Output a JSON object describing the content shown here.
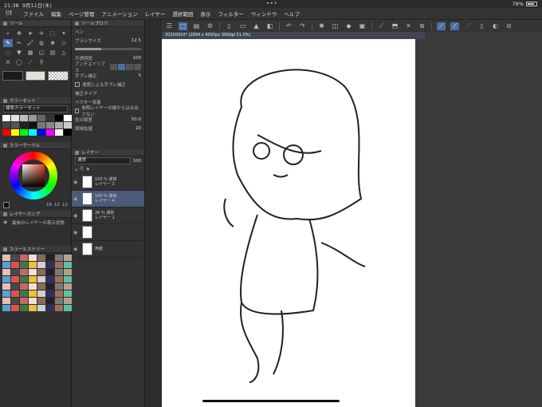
{
  "status": {
    "time": "21:38",
    "date": "9月11日(木)",
    "battery": "78%",
    "battery_level": 0.78
  },
  "menu": [
    "ファイル",
    "編集",
    "ページ管理",
    "アニメーション",
    "レイヤー",
    "選択範囲",
    "表示",
    "フィルター",
    "ウィンドウ",
    "ヘルプ"
  ],
  "tool_panel": {
    "title": "ツール"
  },
  "tool_property": {
    "title": "ツールプロパ",
    "tab": "ペン",
    "brush_size_label": "ブラシサイズ",
    "brush_size": "12.5",
    "opacity_label": "不透明度",
    "opacity": "100",
    "antialias_label": "アンチエイリアス",
    "stabilization_label": "手ブレ補正",
    "stabilization": "5",
    "speed_stab_label": "速度による手ブレ補正",
    "correction_type_label": "補正タイプ",
    "vector_label": "ベクター吸着",
    "ref_layer_label": "参照レイヤーの線からはみ出さない",
    "color_err_label": "色の誤差",
    "color_err": "50.0",
    "area_label": "領域拡縮",
    "area": "20"
  },
  "color_set": {
    "title": "カラーセット",
    "name": "標準カラーセット"
  },
  "color_circle": {
    "title": "カラーサークル",
    "h": "16",
    "s": "12",
    "v": "12"
  },
  "layer_comp": {
    "title": "レイヤーカンプ",
    "item": "最後のレイヤーの表示状態"
  },
  "color_history": {
    "title": "カラーヒストリー"
  },
  "layers": {
    "title": "レイヤー",
    "blend": "通常",
    "opacity": "100",
    "items": [
      {
        "line1": "100 % 通常",
        "line2": "レイヤー 3",
        "selected": false
      },
      {
        "line1": "100 % 通常",
        "line2": "レイヤー 4",
        "selected": true
      },
      {
        "line1": "26 % 通常",
        "line2": "レイヤー 1",
        "selected": false
      },
      {
        "line1": "",
        "line2": "",
        "selected": false
      },
      {
        "line1": "",
        "line2": "用紙",
        "selected": false
      }
    ]
  },
  "document": {
    "tab": "20250910* (2894 x 4093px 300dpi 51.0%)"
  }
}
